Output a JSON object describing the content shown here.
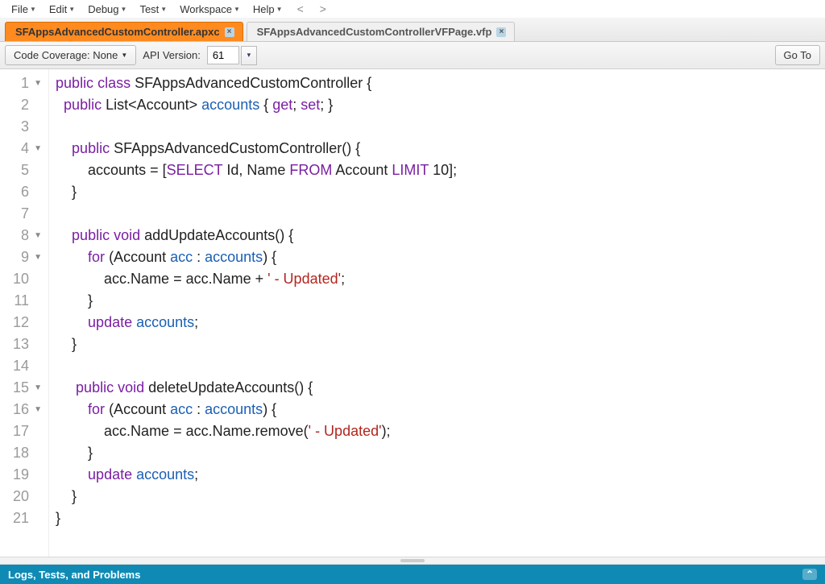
{
  "menu": {
    "items": [
      {
        "label": "File"
      },
      {
        "label": "Edit"
      },
      {
        "label": "Debug"
      },
      {
        "label": "Test"
      },
      {
        "label": "Workspace"
      },
      {
        "label": "Help"
      }
    ]
  },
  "nav": {
    "back": "<",
    "forward": ">"
  },
  "tabs": [
    {
      "label": "SFAppsAdvancedCustomController.apxc",
      "active": true
    },
    {
      "label": "SFAppsAdvancedCustomControllerVFPage.vfp",
      "active": false
    }
  ],
  "toolbar": {
    "coverage_label": "Code Coverage: None",
    "api_label": "API Version:",
    "api_value": "61",
    "goto_label": "Go To"
  },
  "code": {
    "lines": [
      {
        "n": 1,
        "fold": true,
        "tokens": [
          {
            "t": "k",
            "v": "public"
          },
          {
            "t": "p",
            "v": " "
          },
          {
            "t": "k",
            "v": "class"
          },
          {
            "t": "p",
            "v": " SFAppsAdvancedCustomController {"
          }
        ]
      },
      {
        "n": 2,
        "tokens": [
          {
            "t": "p",
            "v": "  "
          },
          {
            "t": "k",
            "v": "public"
          },
          {
            "t": "p",
            "v": " List<Account> "
          },
          {
            "t": "t",
            "v": "accounts"
          },
          {
            "t": "p",
            "v": " { "
          },
          {
            "t": "k",
            "v": "get"
          },
          {
            "t": "p",
            "v": "; "
          },
          {
            "t": "k",
            "v": "set"
          },
          {
            "t": "p",
            "v": "; }"
          }
        ]
      },
      {
        "n": 3,
        "tokens": [
          {
            "t": "p",
            "v": ""
          }
        ]
      },
      {
        "n": 4,
        "fold": true,
        "tokens": [
          {
            "t": "p",
            "v": "    "
          },
          {
            "t": "k",
            "v": "public"
          },
          {
            "t": "p",
            "v": " SFAppsAdvancedCustomController() {"
          }
        ]
      },
      {
        "n": 5,
        "tokens": [
          {
            "t": "p",
            "v": "        accounts = ["
          },
          {
            "t": "k",
            "v": "SELECT"
          },
          {
            "t": "p",
            "v": " Id, Name "
          },
          {
            "t": "k",
            "v": "FROM"
          },
          {
            "t": "p",
            "v": " Account "
          },
          {
            "t": "k",
            "v": "LIMIT"
          },
          {
            "t": "p",
            "v": " 10];"
          }
        ]
      },
      {
        "n": 6,
        "tokens": [
          {
            "t": "p",
            "v": "    }"
          }
        ]
      },
      {
        "n": 7,
        "tokens": [
          {
            "t": "p",
            "v": ""
          }
        ]
      },
      {
        "n": 8,
        "fold": true,
        "tokens": [
          {
            "t": "p",
            "v": "    "
          },
          {
            "t": "k",
            "v": "public"
          },
          {
            "t": "p",
            "v": " "
          },
          {
            "t": "k",
            "v": "void"
          },
          {
            "t": "p",
            "v": " addUpdateAccounts() {"
          }
        ]
      },
      {
        "n": 9,
        "fold": true,
        "tokens": [
          {
            "t": "p",
            "v": "        "
          },
          {
            "t": "k",
            "v": "for"
          },
          {
            "t": "p",
            "v": " (Account "
          },
          {
            "t": "t",
            "v": "acc"
          },
          {
            "t": "p",
            "v": " : "
          },
          {
            "t": "t",
            "v": "accounts"
          },
          {
            "t": "p",
            "v": ") {"
          }
        ]
      },
      {
        "n": 10,
        "tokens": [
          {
            "t": "p",
            "v": "            acc.Name = acc.Name + "
          },
          {
            "t": "s",
            "v": "' - Updated'"
          },
          {
            "t": "p",
            "v": ";"
          }
        ]
      },
      {
        "n": 11,
        "tokens": [
          {
            "t": "p",
            "v": "        }"
          }
        ]
      },
      {
        "n": 12,
        "tokens": [
          {
            "t": "p",
            "v": "        "
          },
          {
            "t": "k",
            "v": "update"
          },
          {
            "t": "p",
            "v": " "
          },
          {
            "t": "t",
            "v": "accounts"
          },
          {
            "t": "p",
            "v": ";"
          }
        ]
      },
      {
        "n": 13,
        "tokens": [
          {
            "t": "p",
            "v": "    }"
          }
        ]
      },
      {
        "n": 14,
        "tokens": [
          {
            "t": "p",
            "v": ""
          }
        ]
      },
      {
        "n": 15,
        "fold": true,
        "tokens": [
          {
            "t": "p",
            "v": "     "
          },
          {
            "t": "k",
            "v": "public"
          },
          {
            "t": "p",
            "v": " "
          },
          {
            "t": "k",
            "v": "void"
          },
          {
            "t": "p",
            "v": " deleteUpdateAccounts() {"
          }
        ]
      },
      {
        "n": 16,
        "fold": true,
        "tokens": [
          {
            "t": "p",
            "v": "        "
          },
          {
            "t": "k",
            "v": "for"
          },
          {
            "t": "p",
            "v": " (Account "
          },
          {
            "t": "t",
            "v": "acc"
          },
          {
            "t": "p",
            "v": " : "
          },
          {
            "t": "t",
            "v": "accounts"
          },
          {
            "t": "p",
            "v": ") {"
          }
        ]
      },
      {
        "n": 17,
        "tokens": [
          {
            "t": "p",
            "v": "            acc.Name = acc.Name.remove("
          },
          {
            "t": "s",
            "v": "' - Updated'"
          },
          {
            "t": "p",
            "v": ");"
          }
        ]
      },
      {
        "n": 18,
        "tokens": [
          {
            "t": "p",
            "v": "        }"
          }
        ]
      },
      {
        "n": 19,
        "tokens": [
          {
            "t": "p",
            "v": "        "
          },
          {
            "t": "k",
            "v": "update"
          },
          {
            "t": "p",
            "v": " "
          },
          {
            "t": "t",
            "v": "accounts"
          },
          {
            "t": "p",
            "v": ";"
          }
        ]
      },
      {
        "n": 20,
        "tokens": [
          {
            "t": "p",
            "v": "    }"
          }
        ]
      },
      {
        "n": 21,
        "tokens": [
          {
            "t": "p",
            "v": "}"
          }
        ]
      }
    ]
  },
  "bottom": {
    "label": "Logs, Tests, and Problems"
  }
}
